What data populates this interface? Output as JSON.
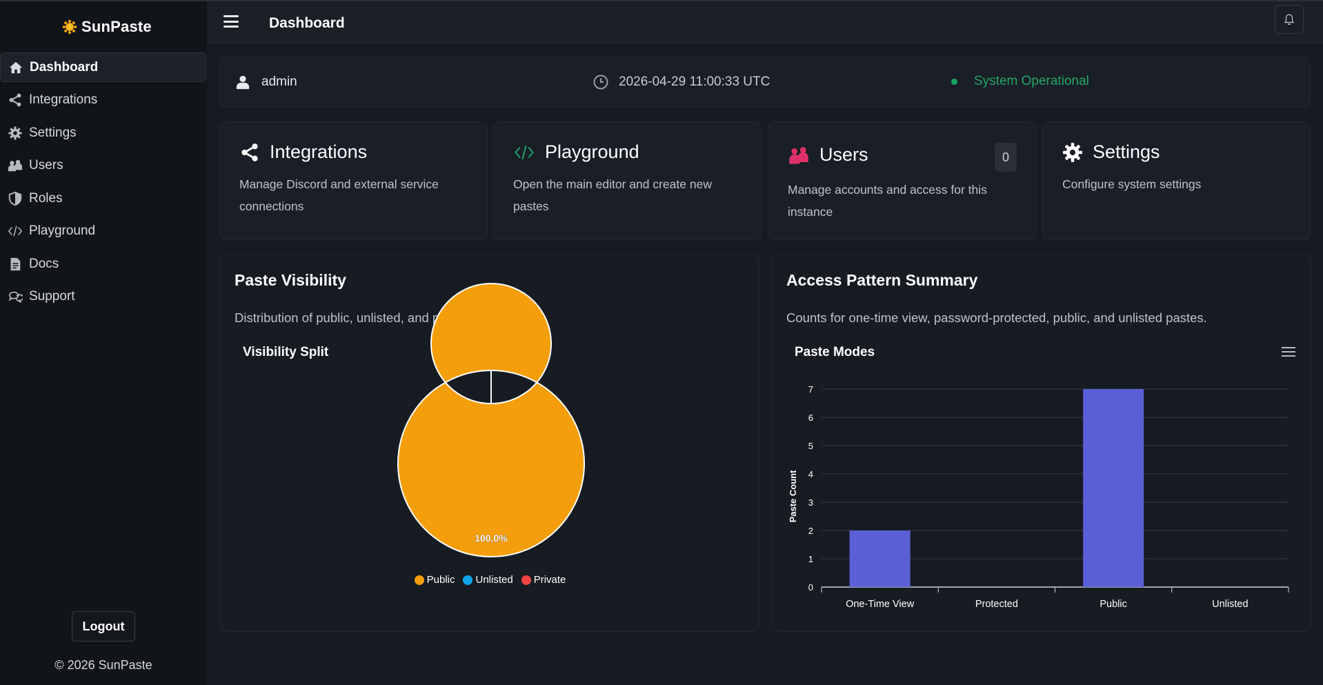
{
  "brand": {
    "name": "SunPaste"
  },
  "sidebar": {
    "items": [
      {
        "label": "Dashboard",
        "icon": "home-icon",
        "active": true
      },
      {
        "label": "Integrations",
        "icon": "share-icon"
      },
      {
        "label": "Settings",
        "icon": "gear-icon"
      },
      {
        "label": "Users",
        "icon": "users-icon"
      },
      {
        "label": "Roles",
        "icon": "shield-icon"
      },
      {
        "label": "Playground",
        "icon": "code-icon"
      },
      {
        "label": "Docs",
        "icon": "document-icon"
      },
      {
        "label": "Support",
        "icon": "chat-icon"
      }
    ],
    "logout_label": "Logout",
    "copyright": "© 2026 SunPaste"
  },
  "header": {
    "title": "Dashboard"
  },
  "status": {
    "user": "admin",
    "time": "2026-04-29 11:00:33 UTC",
    "system": "System Operational"
  },
  "cards": [
    {
      "title": "Integrations",
      "desc": "Manage Discord and external service connections",
      "icon": "share-icon"
    },
    {
      "title": "Playground",
      "desc": "Open the main editor and create new pastes",
      "icon": "code-icon"
    },
    {
      "title": "Users",
      "desc": "Manage accounts and access for this instance",
      "icon": "users-icon",
      "badge": "0"
    },
    {
      "title": "Settings",
      "desc": "Configure system settings",
      "icon": "gear-icon"
    }
  ],
  "visibility_panel": {
    "title": "Paste Visibility",
    "desc": "Distribution of public, unlisted, and private pastes."
  },
  "access_panel": {
    "title": "Access Pattern Summary",
    "desc": "Counts for one-time view, password-protected, public, and unlisted pastes."
  },
  "colors": {
    "public": "#f59e0b",
    "unlisted": "#0ea5e9",
    "private": "#ef4444",
    "bar": "#5b5fd6",
    "operational": "#22a66b"
  },
  "chart_data": [
    {
      "type": "pie",
      "title": "Visibility Split",
      "categories": [
        "Public",
        "Unlisted",
        "Private"
      ],
      "values": [
        100,
        0,
        0
      ],
      "data_label": "100.0%",
      "legend": "bottom"
    },
    {
      "type": "bar",
      "title": "Paste Modes",
      "categories": [
        "One-Time View",
        "Protected",
        "Public",
        "Unlisted"
      ],
      "values": [
        2,
        0,
        7,
        0
      ],
      "ylabel": "Paste Count",
      "xlabel": "",
      "ylim": [
        0,
        7
      ],
      "yticks": [
        0,
        1,
        2,
        3,
        4,
        5,
        6,
        7
      ],
      "grid": true
    }
  ]
}
